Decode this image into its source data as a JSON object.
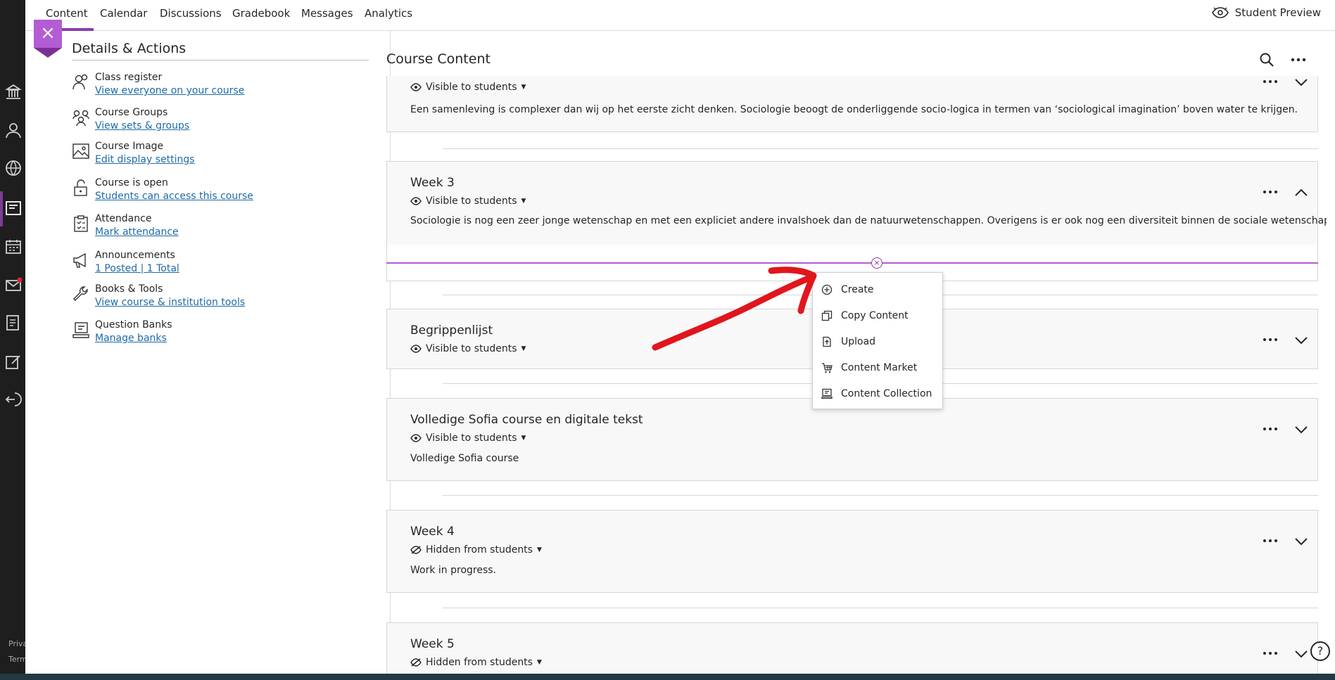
{
  "nav": {
    "tabs": [
      {
        "label": "Content"
      },
      {
        "label": "Calendar"
      },
      {
        "label": "Discussions"
      },
      {
        "label": "Gradebook"
      },
      {
        "label": "Messages"
      },
      {
        "label": "Analytics"
      }
    ],
    "student_preview": "Student Preview"
  },
  "rail": {
    "footer_1": "Priva",
    "footer_2": "Term"
  },
  "details": {
    "title": "Details & Actions",
    "items": [
      {
        "title": "Class register",
        "link": "View everyone on your course",
        "icon": "users-icon"
      },
      {
        "title": "Course Groups",
        "link": "View sets & groups",
        "icon": "groups-icon"
      },
      {
        "title": "Course Image",
        "link": "Edit display settings",
        "icon": "image-icon"
      },
      {
        "title": "Course is open",
        "link": "Students can access this course",
        "icon": "unlock-icon"
      },
      {
        "title": "Attendance",
        "link": "Mark attendance",
        "icon": "clipboard-icon"
      },
      {
        "title": "Announcements",
        "link": "1 Posted | 1 Total",
        "icon": "megaphone-icon"
      },
      {
        "title": "Books & Tools",
        "link": "View course & institution tools",
        "icon": "wrench-icon"
      },
      {
        "title": "Question Banks",
        "link": "Manage banks",
        "icon": "bank-icon"
      }
    ]
  },
  "content": {
    "title": "Course Content",
    "cards": [
      {
        "title": "",
        "visibility": "Visible to students",
        "desc": "Een samenleving is complexer dan wij op het eerste zicht denken. Sociologie beoogt de onderliggende socio-logica in termen van ‘sociological imagination’ boven water te krijgen.",
        "expanded": false
      },
      {
        "title": "Week 3",
        "visibility": "Visible to students",
        "desc": "Sociologie is nog een zeer jonge wetenschap en met een expliciet andere invalshoek dan de natuurwetenschappen. Overigens is er ook nog een diversiteit binnen de sociale wetenschappen.",
        "expanded": true
      },
      {
        "title": "Begrippenlijst",
        "visibility": "Visible to students",
        "desc": "",
        "expanded": false
      },
      {
        "title": "Volledige Sofia course en digitale tekst",
        "visibility": "Visible to students",
        "desc": "Volledige Sofia course",
        "expanded": false
      },
      {
        "title": "Week 4",
        "visibility": "Hidden from students",
        "desc": "Work in progress.",
        "expanded": false
      },
      {
        "title": "Week 5",
        "visibility": "Hidden from students",
        "desc": "",
        "expanded": false
      }
    ]
  },
  "menu": {
    "items": [
      {
        "label": "Create",
        "icon": "plus-circle-icon"
      },
      {
        "label": "Copy Content",
        "icon": "copy-icon"
      },
      {
        "label": "Upload",
        "icon": "upload-icon"
      },
      {
        "label": "Content Market",
        "icon": "cart-icon"
      },
      {
        "label": "Content Collection",
        "icon": "collection-icon"
      }
    ]
  },
  "help": {
    "label": "?"
  },
  "colors": {
    "accent": "#8b3ba8",
    "accent_light": "#b35cd3",
    "link": "#1f6ba8",
    "annotation": "#e0161d"
  }
}
